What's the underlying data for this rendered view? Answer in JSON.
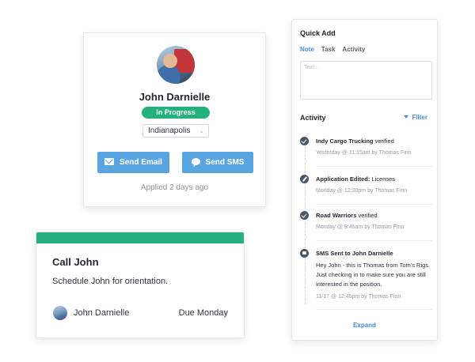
{
  "profile": {
    "name": "John Darnielle",
    "status": "In Progress",
    "location": "Indianapolis",
    "send_email": "Send Email",
    "send_sms": "Send SMS",
    "applied": "Applied 2 days ago",
    "colors": {
      "status": "#22b37d",
      "button": "#5aa4e2"
    }
  },
  "task": {
    "title": "Call John",
    "description": "Schedule John for orientation.",
    "assignee": "John Darnielle",
    "due": "Due Monday",
    "accent": "#27b07d"
  },
  "panel": {
    "quick_add_title": "Quick Add",
    "tabs": [
      "Note",
      "Task",
      "Activity"
    ],
    "active_tab": "Note",
    "placeholder": "Text...",
    "activity_title": "Activity",
    "filter_label": "Filter",
    "items": [
      {
        "icon": "check-icon",
        "title": "Indy Cargo Trucking",
        "suffix": " verified",
        "meta": "Yesterday @ 11:15am by Thomas Finn"
      },
      {
        "icon": "pencil-icon",
        "title": "Application Edited:",
        "suffix": " Licenses",
        "meta": "Monday @ 12:30pm by Thomas Finn"
      },
      {
        "icon": "check-icon",
        "title": "Road Warriors",
        "suffix": " verified",
        "meta": "Monday @ 9:45am by Thomas Finn"
      },
      {
        "icon": "message-icon",
        "title": "SMS Sent to John Darnielle",
        "suffix": "",
        "body": "Hey John - this is Thomas from Tom's Rigs. Just checking in to make sure you are still interested in the position.",
        "meta": "11/17 @ 12:45pm by Thomas Finn"
      }
    ],
    "expand_label": "Expand",
    "link_color": "#3e8ed6"
  }
}
